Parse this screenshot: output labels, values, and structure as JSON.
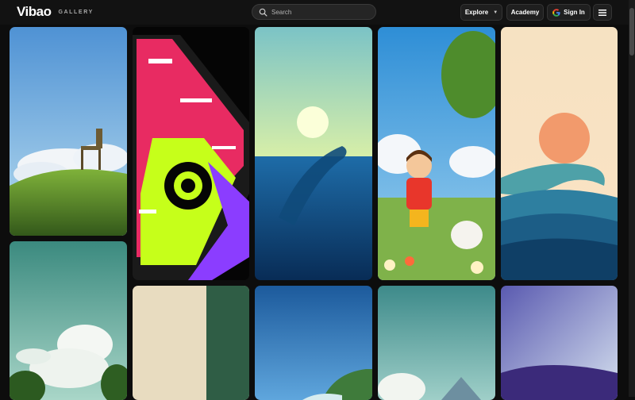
{
  "brand": {
    "name": "Vibao",
    "sub": "GALLERY"
  },
  "search": {
    "placeholder": "Search"
  },
  "nav": {
    "explore_label": "Explore",
    "academy_label": "Academy",
    "signin_label": "Sign In"
  },
  "gallery": {
    "items": [
      {
        "subject": "chair-on-grassy-hill"
      },
      {
        "subject": "neon-circuit-pattern"
      },
      {
        "subject": "whale-under-sun"
      },
      {
        "subject": "boy-and-dog-in-meadow"
      },
      {
        "subject": "sunset-wave"
      },
      {
        "subject": "clouds-and-trees"
      },
      {
        "subject": "beige-and-green-paper"
      },
      {
        "subject": "blue-sky-island"
      },
      {
        "subject": "clouds-over-mountains"
      },
      {
        "subject": "purple-abstract"
      }
    ]
  },
  "colors": {
    "background": "#0d0d0d",
    "header": "#121212",
    "google_blue": "#4285F4"
  }
}
